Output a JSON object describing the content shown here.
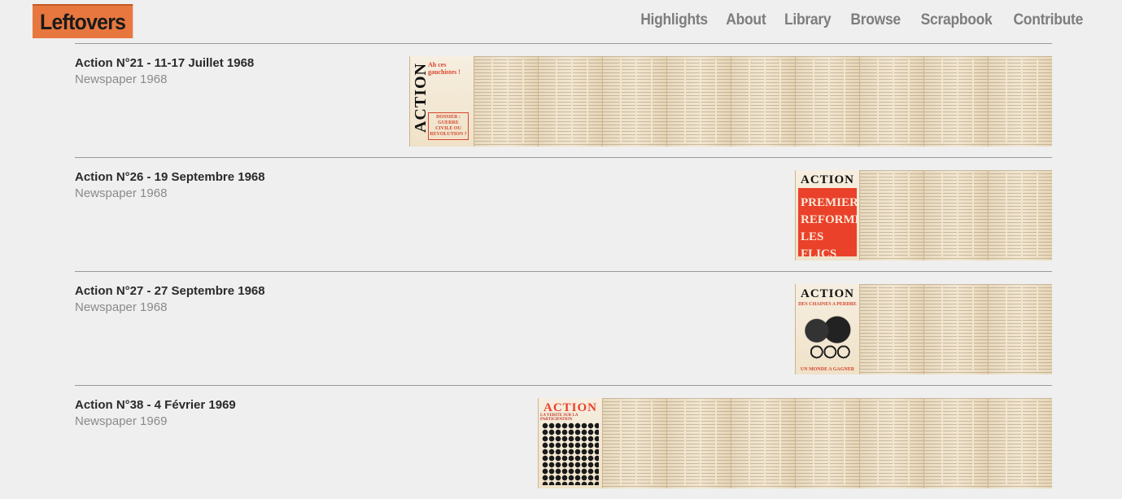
{
  "logo": {
    "text": "Leftovers"
  },
  "nav": [
    {
      "label": "Highlights"
    },
    {
      "label": "About"
    },
    {
      "label": "Library"
    },
    {
      "label": "Browse"
    },
    {
      "label": "Scrapbook"
    },
    {
      "label": "Contribute"
    }
  ],
  "items": [
    {
      "title": "Action N°21 - 11-17 Juillet 1968",
      "subtitle": "Newspaper 1968",
      "cover_vertical": "ACTION",
      "cover_redtext": "Ah ces gauchistes !",
      "cover_box": "DOSSIER : GUERRE CIVILE OU REVOLUTION ?"
    },
    {
      "title": "Action N°26 - 19 Septembre 1968",
      "subtitle": "Newspaper 1968",
      "cover_title": "ACTION",
      "cover_headline": "PREMIERE REFORME: LES FLICS"
    },
    {
      "title": "Action N°27 - 27 Septembre 1968",
      "subtitle": "Newspaper 1968",
      "cover_title": "ACTION",
      "cover_sub": "DES CHAINES A PERDRE",
      "cover_foot": "UN MONDE A GAGNER"
    },
    {
      "title": "Action N°38 - 4 Février 1969",
      "subtitle": "Newspaper 1969",
      "cover_title": "ACTION",
      "cover_small": "LA VERITE SUR LA PARTICIPATION"
    }
  ]
}
